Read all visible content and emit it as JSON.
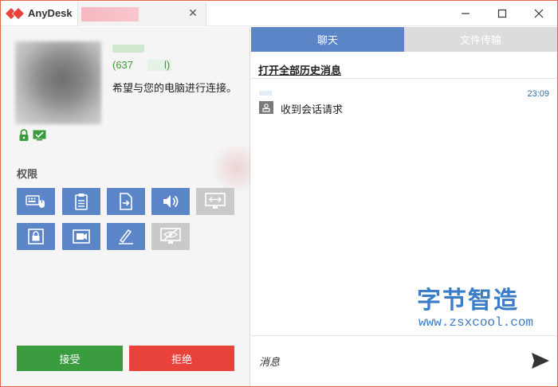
{
  "titlebar": {
    "app_name": "AnyDesk",
    "tab_close_glyph": "✕"
  },
  "colors": {
    "accent_blue": "#5b85c7",
    "accept_green": "#3a9b3f",
    "reject_red": "#e8423b",
    "disabled_gray": "#c9c9c9",
    "brand_red": "#e8423b",
    "id_green": "#3b9b3b",
    "time_blue": "#2e6fb0"
  },
  "caller": {
    "id_partial": "(637",
    "id_suffix": "l)",
    "request_message": "希望与您的电脑进行连接。"
  },
  "permissions": {
    "title": "权限",
    "items": [
      {
        "icon": "keyboard-mouse-icon",
        "enabled": true
      },
      {
        "icon": "clipboard-icon",
        "enabled": true
      },
      {
        "icon": "file-transfer-icon",
        "enabled": true
      },
      {
        "icon": "sound-icon",
        "enabled": true
      },
      {
        "icon": "screen-control-icon",
        "enabled": false
      },
      {
        "icon": "lock-screen-icon",
        "enabled": true
      },
      {
        "icon": "record-session-icon",
        "enabled": true
      },
      {
        "icon": "draw-pen-icon",
        "enabled": true
      },
      {
        "icon": "privacy-mode-icon",
        "enabled": false
      }
    ]
  },
  "actions": {
    "accept_label": "接受",
    "reject_label": "拒绝"
  },
  "chat": {
    "tabs": {
      "chat_label": "聊天",
      "files_label": "文件传输"
    },
    "history_link": "打开全部历史消息",
    "messages": [
      {
        "time": "23:09",
        "text": "收到会话请求"
      }
    ],
    "input_placeholder": "消息"
  },
  "watermark": {
    "logo_text": "字节智造",
    "url": "www.zsxcool.com"
  }
}
